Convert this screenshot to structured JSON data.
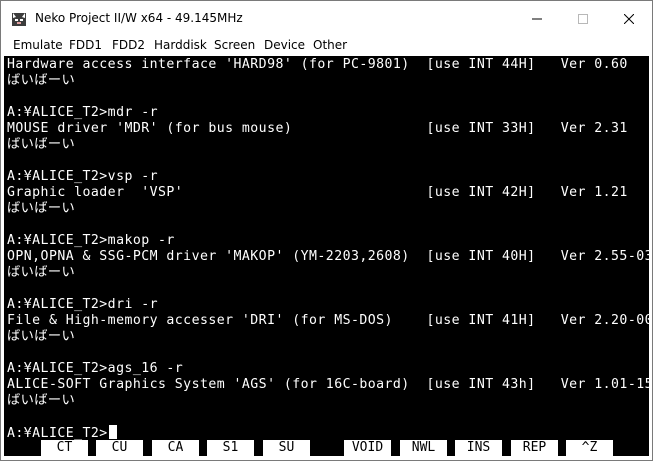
{
  "window": {
    "title": "Neko Project II/W x64 - 49.145MHz"
  },
  "menubar": {
    "items": [
      "Emulate",
      "FDD1",
      "FDD2",
      "Harddisk",
      "Screen",
      "Device",
      "Other"
    ]
  },
  "console": {
    "lines": [
      "Hardware access interface 'HARD98' (for PC-9801)  [use INT 44H]   Ver 0.60",
      "ばいばーい",
      "",
      "A:¥ALICE_T2>mdr -r",
      "MOUSE driver 'MDR' (for bus mouse)                [use INT 33H]   Ver 2.31",
      "ばいばーい",
      "",
      "A:¥ALICE_T2>vsp -r",
      "Graphic loader  'VSP'                             [use INT 42H]   Ver 1.21",
      "ばいばーい",
      "",
      "A:¥ALICE_T2>makop -r",
      "OPN,OPNA & SSG-PCM driver 'MAKOP' (YM-2203,2608)  [use INT 40H]   Ver 2.55-03",
      "ばいばーい",
      "",
      "A:¥ALICE_T2>dri -r",
      "File & High-memory accesser 'DRI' (for MS-DOS)    [use INT 41H]   Ver 2.20-00",
      "ばいばーい",
      "",
      "A:¥ALICE_T2>ags_16 -r",
      "ALICE-SOFT Graphics System 'AGS' (for 16C-board)  [use INT 43h]   Ver 1.01-15",
      "ばいばーい",
      "",
      "A:¥ALICE_T2>"
    ]
  },
  "function_keys": [
    "CT",
    "CU",
    "CA",
    "S1",
    "SU",
    "VOID",
    "NWL",
    "INS",
    "REP",
    "^Z"
  ]
}
